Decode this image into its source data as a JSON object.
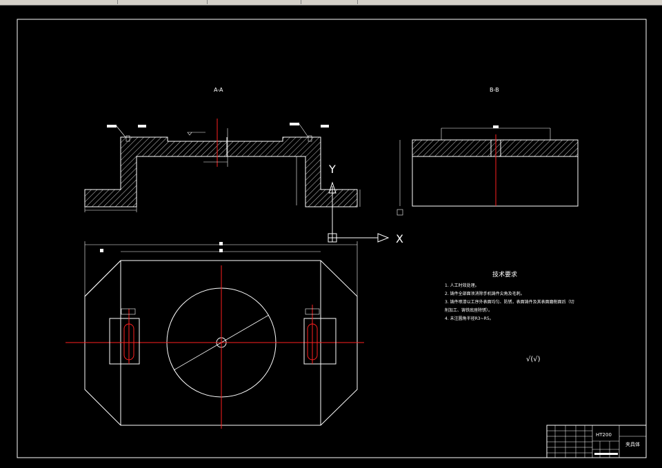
{
  "drawing": {
    "views": {
      "section_a": {
        "label": "A-A"
      },
      "section_b": {
        "label": "B-B"
      }
    },
    "ucs": {
      "x_label": "X",
      "y_label": "Y"
    },
    "technical_requirements": {
      "title": "技术要求",
      "items": [
        "1. 人工时效处理。",
        "2. 铸件全部面须消除手机铸件尖角及毛刺。",
        "3. 铸件喷漆以工序外表面均匀、防锈，表面铸件及其表面磨削面后（切",
        "   削加工、铸铁底座除锈）。",
        "4. 未注圆角半径R3~R5。"
      ]
    },
    "roughness_note": "√(√)",
    "title_block": {
      "name": "夹具体",
      "material": "HT200"
    }
  },
  "colors": {
    "background": "#000000",
    "lines": "#ffffff",
    "centerlines": "#ff2020"
  }
}
